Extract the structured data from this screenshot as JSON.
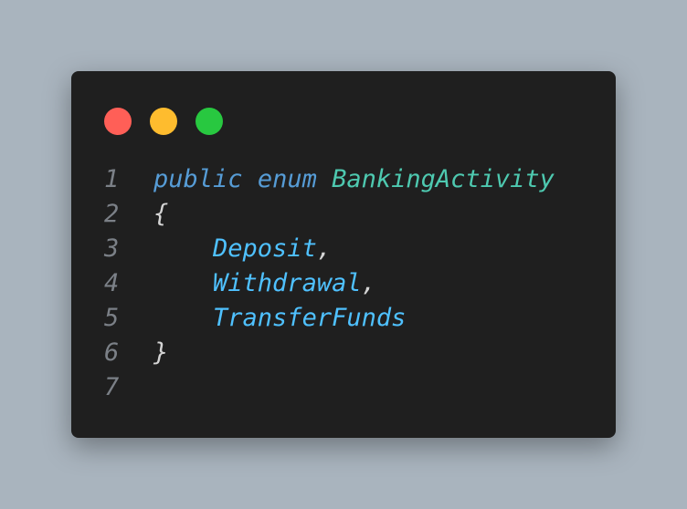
{
  "colors": {
    "background": "#a9b4be",
    "window": "#1f1f1f",
    "dot_red": "#ff5f57",
    "dot_yellow": "#febc2e",
    "dot_green": "#28c840",
    "line_number": "#7b8087",
    "keyword": "#569cd6",
    "type_name": "#4ec9b0",
    "member": "#4fc1ff",
    "punctuation": "#d4d4d4"
  },
  "editor": {
    "lines": [
      {
        "number": "1",
        "tokens": [
          {
            "text": "public",
            "role": "keyword"
          },
          {
            "text": " ",
            "role": "punctuation"
          },
          {
            "text": "enum",
            "role": "keyword"
          },
          {
            "text": " ",
            "role": "punctuation"
          },
          {
            "text": "BankingActivity",
            "role": "type_name"
          }
        ]
      },
      {
        "number": "2",
        "tokens": [
          {
            "text": "{",
            "role": "punctuation"
          }
        ]
      },
      {
        "number": "3",
        "tokens": [
          {
            "text": "    ",
            "role": "punctuation"
          },
          {
            "text": "Deposit",
            "role": "member"
          },
          {
            "text": ",",
            "role": "punctuation"
          }
        ]
      },
      {
        "number": "4",
        "tokens": [
          {
            "text": "    ",
            "role": "punctuation"
          },
          {
            "text": "Withdrawal",
            "role": "member"
          },
          {
            "text": ",",
            "role": "punctuation"
          }
        ]
      },
      {
        "number": "5",
        "tokens": [
          {
            "text": "    ",
            "role": "punctuation"
          },
          {
            "text": "TransferFunds",
            "role": "member"
          }
        ]
      },
      {
        "number": "6",
        "tokens": [
          {
            "text": "}",
            "role": "punctuation"
          }
        ]
      },
      {
        "number": "7",
        "tokens": []
      }
    ]
  }
}
